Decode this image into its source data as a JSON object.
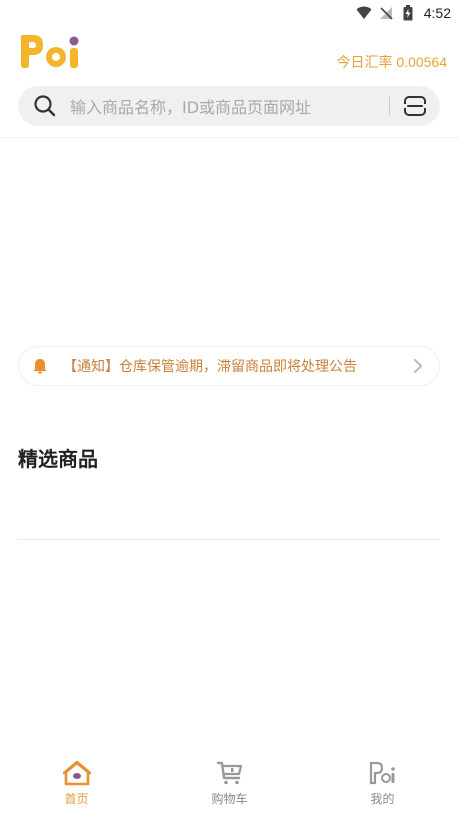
{
  "status_bar": {
    "time": "4:52"
  },
  "header": {
    "logo_text": "Poi",
    "exchange_rate": "今日汇率 0.00564"
  },
  "search": {
    "placeholder": "输入商品名称，ID或商品页面网址"
  },
  "notice": {
    "text": "【通知】仓库保管逾期，滞留商品即将处理公告"
  },
  "featured": {
    "title": "精选商品"
  },
  "tabbar": {
    "items": [
      {
        "label": "首页",
        "icon": "home-icon",
        "active": true
      },
      {
        "label": "购物车",
        "icon": "cart-icon",
        "active": false
      },
      {
        "label": "我的",
        "icon": "profile-icon",
        "active": false
      }
    ]
  },
  "colors": {
    "accent": "#e8a23a",
    "notice_text": "#c9813a",
    "logo_yellow": "#f3b62a",
    "logo_purple": "#8a5a8c"
  }
}
